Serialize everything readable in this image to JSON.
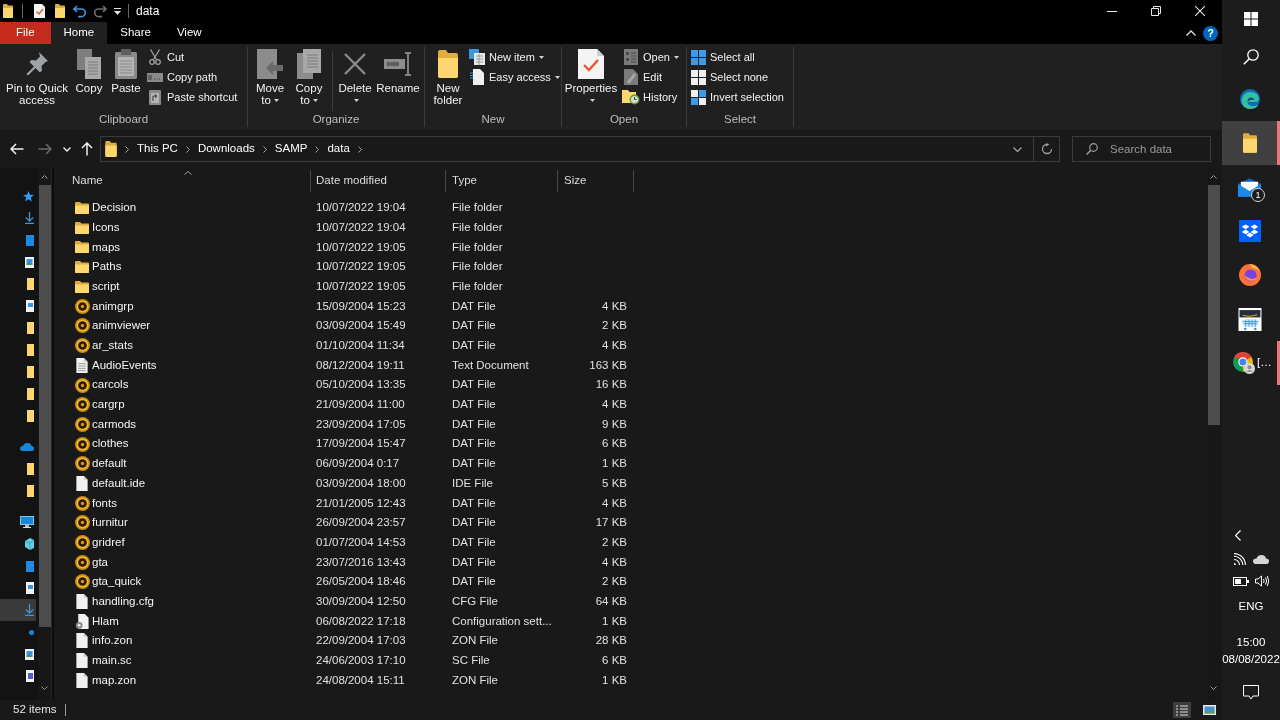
{
  "window": {
    "title": "data"
  },
  "ribbon": {
    "tabs": [
      {
        "label": "File",
        "kind": "file",
        "selected": false
      },
      {
        "label": "Home",
        "kind": "tab",
        "selected": true
      },
      {
        "label": "Share",
        "kind": "tab",
        "selected": false
      },
      {
        "label": "View",
        "kind": "tab",
        "selected": false
      }
    ],
    "help": "?",
    "groups": [
      {
        "label": "Clipboard",
        "sections": [
          [
            {
              "kind": "pin",
              "label": "Pin to Quick access",
              "dropdown": false
            },
            {
              "kind": "copy",
              "label": "Copy",
              "dropdown": false
            },
            {
              "kind": "paste",
              "label": "Paste",
              "dropdown": false
            },
            {
              "kind": "cut",
              "label": "Cut",
              "dropdown": false
            },
            {
              "kind": "copypath",
              "label": "Copy path",
              "dropdown": false
            },
            {
              "kind": "pasteshortcut",
              "label": "Paste shortcut",
              "dropdown": false
            }
          ]
        ]
      },
      {
        "label": "Organize",
        "sections": [
          [
            {
              "kind": "moveto",
              "label": "Move to",
              "dropdown": true
            },
            {
              "kind": "copyto",
              "label": "Copy to",
              "dropdown": true
            }
          ],
          [
            {
              "kind": "delete",
              "label": "Delete",
              "dropdown": true
            },
            {
              "kind": "rename",
              "label": "Rename",
              "dropdown": false
            }
          ]
        ]
      },
      {
        "label": "New",
        "sections": [
          [
            {
              "kind": "newfolder",
              "label": "New folder",
              "dropdown": false
            },
            {
              "kind": "newitem",
              "label": "New item",
              "dropdown": true
            },
            {
              "kind": "easyaccess",
              "label": "Easy access",
              "dropdown": true
            }
          ]
        ]
      },
      {
        "label": "Open",
        "sections": [
          [
            {
              "kind": "properties",
              "label": "Properties",
              "dropdown": true
            },
            {
              "kind": "open",
              "label": "Open",
              "dropdown": true
            },
            {
              "kind": "edit",
              "label": "Edit",
              "dropdown": false
            },
            {
              "kind": "history",
              "label": "History",
              "dropdown": false
            }
          ]
        ]
      },
      {
        "label": "Select",
        "sections": [
          [
            {
              "kind": "selectall",
              "label": "Select all",
              "dropdown": false
            },
            {
              "kind": "selectnone",
              "label": "Select none",
              "dropdown": false
            },
            {
              "kind": "invert",
              "label": "Invert selection",
              "dropdown": false
            }
          ]
        ]
      }
    ]
  },
  "navigation": {
    "buttons": [
      {
        "kind": "back",
        "disabled": false
      },
      {
        "kind": "forward",
        "disabled": true
      },
      {
        "kind": "recent",
        "disabled": false
      },
      {
        "kind": "up",
        "disabled": false
      }
    ],
    "breadcrumbs": [
      "This PC",
      "Downloads",
      "SAMP",
      "data"
    ]
  },
  "search": {
    "placeholder": "Search data"
  },
  "nav_pane": {
    "sections": [
      [
        {
          "kind": "star",
          "selected": false
        },
        {
          "kind": "download",
          "selected": false
        },
        {
          "kind": "desktop",
          "selected": false
        },
        {
          "kind": "picture",
          "selected": false
        },
        {
          "kind": "folder",
          "selected": false
        },
        {
          "kind": "document",
          "selected": false
        },
        {
          "kind": "folder",
          "selected": false
        },
        {
          "kind": "folder",
          "selected": false
        },
        {
          "kind": "folder",
          "selected": false
        },
        {
          "kind": "folder",
          "selected": false
        },
        {
          "kind": "folder",
          "selected": false
        }
      ],
      [
        {
          "kind": "cloud",
          "selected": false
        },
        {
          "kind": "folder",
          "selected": false
        },
        {
          "kind": "folder",
          "selected": false
        }
      ],
      [
        {
          "kind": "monitor",
          "selected": false
        },
        {
          "kind": "cube",
          "selected": false
        },
        {
          "kind": "desktop",
          "selected": false
        },
        {
          "kind": "document",
          "selected": false
        },
        {
          "kind": "download",
          "selected": true
        },
        {
          "kind": "music",
          "selected": false
        },
        {
          "kind": "picture",
          "selected": false
        },
        {
          "kind": "video",
          "selected": false
        }
      ]
    ]
  },
  "file_list": {
    "columns": [
      {
        "label": "Name",
        "sorted": true
      },
      {
        "label": "Date modified",
        "sorted": false
      },
      {
        "label": "Type",
        "sorted": false
      },
      {
        "label": "Size",
        "sorted": false
      }
    ],
    "rows": [
      {
        "kind": "folder",
        "name": "Decision",
        "date": "10/07/2022 19:04",
        "type": "File folder"
      },
      {
        "kind": "folder",
        "name": "Icons",
        "date": "10/07/2022 19:04",
        "type": "File folder"
      },
      {
        "kind": "folder",
        "name": "maps",
        "date": "10/07/2022 19:05",
        "type": "File folder"
      },
      {
        "kind": "folder",
        "name": "Paths",
        "date": "10/07/2022 19:05",
        "type": "File folder"
      },
      {
        "kind": "folder",
        "name": "script",
        "date": "10/07/2022 19:05",
        "type": "File folder"
      },
      {
        "kind": "dat",
        "name": "animgrp",
        "date": "15/09/2004 15:23",
        "type": "DAT File",
        "size": "4 KB"
      },
      {
        "kind": "dat",
        "name": "animviewer",
        "date": "03/09/2004 15:49",
        "type": "DAT File",
        "size": "2 KB"
      },
      {
        "kind": "dat",
        "name": "ar_stats",
        "date": "01/10/2004 11:34",
        "type": "DAT File",
        "size": "4 KB"
      },
      {
        "kind": "text",
        "name": "AudioEvents",
        "date": "08/12/2004 19:11",
        "type": "Text Document",
        "size": "163 KB"
      },
      {
        "kind": "dat",
        "name": "carcols",
        "date": "05/10/2004 13:35",
        "type": "DAT File",
        "size": "16 KB"
      },
      {
        "kind": "dat",
        "name": "cargrp",
        "date": "21/09/2004 11:00",
        "type": "DAT File",
        "size": "4 KB"
      },
      {
        "kind": "dat",
        "name": "carmods",
        "date": "23/09/2004 17:05",
        "type": "DAT File",
        "size": "9 KB"
      },
      {
        "kind": "dat",
        "name": "clothes",
        "date": "17/09/2004 15:47",
        "type": "DAT File",
        "size": "6 KB"
      },
      {
        "kind": "dat",
        "name": "default",
        "date": "06/09/2004 0:17",
        "type": "DAT File",
        "size": "1 KB"
      },
      {
        "kind": "file",
        "name": "default.ide",
        "date": "03/09/2004 18:00",
        "type": "IDE File",
        "size": "5 KB"
      },
      {
        "kind": "dat",
        "name": "fonts",
        "date": "21/01/2005 12:43",
        "type": "DAT File",
        "size": "4 KB"
      },
      {
        "kind": "dat",
        "name": "furnitur",
        "date": "26/09/2004 23:57",
        "type": "DAT File",
        "size": "17 KB"
      },
      {
        "kind": "dat",
        "name": "gridref",
        "date": "01/07/2004 14:53",
        "type": "DAT File",
        "size": "2 KB"
      },
      {
        "kind": "dat",
        "name": "gta",
        "date": "23/07/2016 13:43",
        "type": "DAT File",
        "size": "4 KB"
      },
      {
        "kind": "dat",
        "name": "gta_quick",
        "date": "26/05/2004 18:46",
        "type": "DAT File",
        "size": "2 KB"
      },
      {
        "kind": "file",
        "name": "handling.cfg",
        "date": "30/09/2004 12:50",
        "type": "CFG File",
        "size": "64 KB"
      },
      {
        "kind": "config",
        "name": "Hlam",
        "date": "06/08/2022 17:18",
        "type": "Configuration sett...",
        "size": "1 KB"
      },
      {
        "kind": "file",
        "name": "info.zon",
        "date": "22/09/2004 17:03",
        "type": "ZON File",
        "size": "28 KB"
      },
      {
        "kind": "file",
        "name": "main.sc",
        "date": "24/06/2003 17:10",
        "type": "SC File",
        "size": "6 KB"
      },
      {
        "kind": "file",
        "name": "map.zon",
        "date": "24/08/2004 15:11",
        "type": "ZON File",
        "size": "1 KB"
      }
    ]
  },
  "status_bar": {
    "item_count": "52 items",
    "views": [
      {
        "kind": "details",
        "selected": true
      },
      {
        "kind": "tiles",
        "selected": false
      }
    ]
  },
  "taskbar": {
    "apps": [
      {
        "kind": "edge",
        "running": false,
        "active": false
      },
      {
        "kind": "explorer",
        "running": true,
        "active": true
      },
      {
        "kind": "mail",
        "running": false,
        "active": false,
        "badge": "1"
      },
      {
        "kind": "dropbox",
        "running": false,
        "active": false
      },
      {
        "kind": "firefox",
        "running": false,
        "active": false
      },
      {
        "kind": "amazon",
        "running": false,
        "active": false
      },
      {
        "kind": "chrome",
        "running": true,
        "active": false,
        "label": "[…"
      }
    ],
    "tray": {
      "language": "ENG",
      "time": "15:00",
      "date": "08/08/2022"
    }
  }
}
